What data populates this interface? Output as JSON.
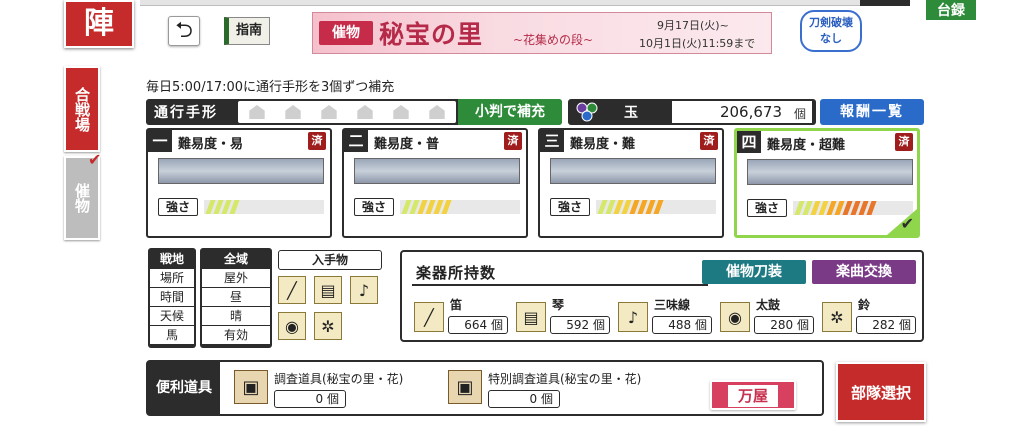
{
  "header": {
    "shutsujin_label": "陣",
    "right_tag_label": "台録",
    "guide_label": "指南",
    "back_icon": "back-arrow-icon"
  },
  "banner": {
    "tag": "催物",
    "title": "秘宝の里",
    "subtitle": "~花集めの段~",
    "date_start": "9月17日(火)~",
    "date_end": "10月1日(火)11:59まで"
  },
  "breaking": {
    "line1": "刀剣破壊",
    "line2": "なし"
  },
  "sidebar": {
    "tab_battle": "合戦場",
    "tab_event": "催物"
  },
  "notice": "毎日5:00/17:00に通行手形を3個ずつ補充",
  "pass_bar": {
    "label": "通行手形",
    "pass_count": 6,
    "koban_button": "小判で補充"
  },
  "gyoku": {
    "label": "玉",
    "value": "206,673",
    "unit": "個"
  },
  "reward_button": "報酬一覧",
  "difficulties": [
    {
      "num": "一",
      "name": "難易度・易",
      "done": "済",
      "strength_label": "強さ",
      "level": 0
    },
    {
      "num": "二",
      "name": "難易度・普",
      "done": "済",
      "strength_label": "強さ",
      "level": 1
    },
    {
      "num": "三",
      "name": "難易度・難",
      "done": "済",
      "strength_label": "強さ",
      "level": 2
    },
    {
      "num": "四",
      "name": "難易度・超難",
      "done": "済",
      "strength_label": "強さ",
      "level": 3
    }
  ],
  "conditions": {
    "col1": [
      "戦地",
      "場所",
      "時間",
      "天候",
      "馬"
    ],
    "col2": [
      "全域",
      "屋外",
      "昼",
      "晴",
      "有効"
    ],
    "drops_label": "入手物"
  },
  "instruments": {
    "title": "楽器所持数",
    "sword_button": "催物刀装",
    "music_button": "楽曲交換",
    "unit": "個",
    "items": [
      {
        "name": "笛",
        "count": "664",
        "icon": "flute-icon"
      },
      {
        "name": "琴",
        "count": "592",
        "icon": "koto-icon"
      },
      {
        "name": "三味線",
        "count": "488",
        "icon": "shamisen-icon"
      },
      {
        "name": "太鼓",
        "count": "280",
        "icon": "drum-icon"
      },
      {
        "name": "鈴",
        "count": "282",
        "icon": "bell-icon"
      }
    ]
  },
  "tools": {
    "label": "便利道具",
    "unit": "個",
    "items": [
      {
        "name": "調査道具(秘宝の里・花)",
        "count": "0"
      },
      {
        "name": "特別調査道具(秘宝の里・花)",
        "count": "0"
      }
    ],
    "yorozu_button": "万屋"
  },
  "squad_button": "部隊選択",
  "colors": {
    "accent_red": "#c62b2b",
    "green": "#2e8b3a",
    "blue": "#2a6ac8",
    "teal": "#1e7a82",
    "purple": "#7a3a86",
    "selected_border": "#8fd64c"
  }
}
